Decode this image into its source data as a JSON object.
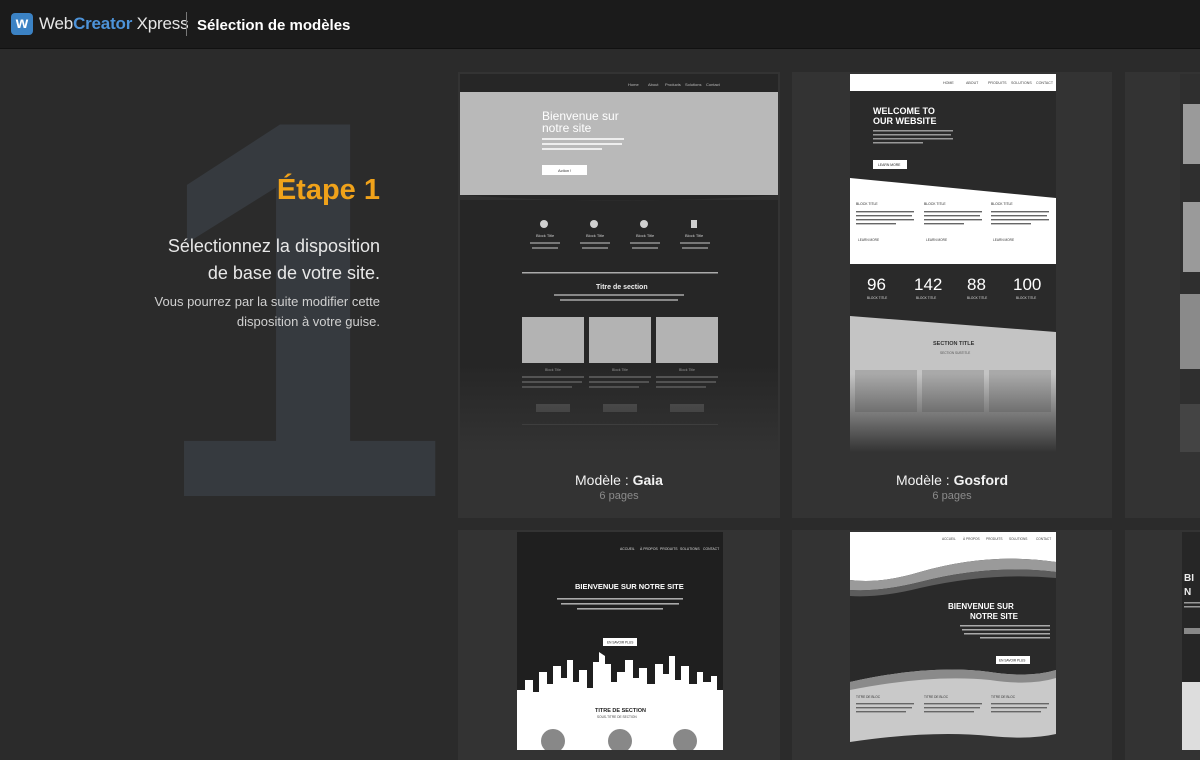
{
  "header": {
    "brand_part1": "Web",
    "brand_part2": "Creator",
    "brand_part3": " Xpress",
    "logo_letter": "w",
    "title": "Sélection de modèles"
  },
  "step": {
    "number": "1",
    "title": "Étape 1",
    "line1": "Sélectionnez la disposition",
    "line2": "de base de votre site.",
    "sub1": "Vous pourrez par la suite modifier cette",
    "sub2": "disposition à votre guise."
  },
  "models": [
    {
      "prefix": "Modèle : ",
      "name": "Gaia",
      "pages": "6 pages",
      "nav": [
        "Home",
        "About",
        "Products",
        "Solutions",
        "Contact"
      ],
      "hero_title_1": "Bienvenue sur",
      "hero_title_2": "notre site",
      "hero_button": "Action !",
      "block_title": "Block Title",
      "section_title": "Titre de section"
    },
    {
      "prefix": "Modèle : ",
      "name": "Gosford",
      "pages": "6 pages",
      "nav": [
        "HOME",
        "ABOUT",
        "PRODUITS",
        "SOLUTIONS",
        "CONTACT"
      ],
      "hero_title_1": "WELCOME TO",
      "hero_title_2": "OUR WEBSITE",
      "hero_button": "LEARN MORE",
      "block_title": "BLOCK TITLE",
      "learn_more": "LEARN MORE",
      "stats": [
        "96",
        "142",
        "88",
        "100"
      ],
      "section_title": "SECTION TITLE",
      "section_subtitle": "SECTION SUBTITLE"
    },
    {
      "nav": [
        "ACCUEIL",
        "À PROPOS",
        "PRODUITS",
        "SOLUTIONS",
        "CONTACT"
      ],
      "hero_title": "BIENVENUE SUR NOTRE SITE",
      "hero_button": "EN SAVOIR PLUS",
      "section_title": "TITRE DE SECTION",
      "section_subtitle": "SOUS-TITRE DE SECTION"
    },
    {
      "nav": [
        "ACCUEIL",
        "À PROPOS",
        "PRODUITS",
        "SOLUTIONS",
        "CONTACT"
      ],
      "hero_title_1": "BIENVENUE SUR",
      "hero_title_2": "NOTRE SITE",
      "hero_button": "EN SAVOIR PLUS",
      "block_title": "TITRE DE BLOC"
    }
  ],
  "partial_text": [
    "BI",
    "N"
  ]
}
